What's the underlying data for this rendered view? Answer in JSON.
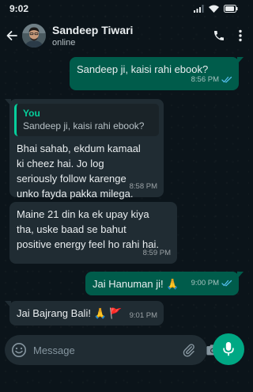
{
  "status_bar": {
    "time": "9:02"
  },
  "header": {
    "contact_name": "Sandeep Tiwari",
    "contact_status": "online"
  },
  "messages": [
    {
      "direction": "out",
      "text": "Sandeep ji, kaisi rahi ebook?",
      "time": "8:56 PM",
      "read": true
    },
    {
      "direction": "in",
      "quote_author": "You",
      "quote_text": "Sandeep ji, kaisi rahi ebook?",
      "text": "Bhai sahab, ekdum kamaal ki cheez hai. Jo log seriously follow karenge unko fayda pakka milega.",
      "time": "8:58 PM"
    },
    {
      "direction": "in",
      "text": "Maine 21 din ka ek upay kiya tha, uske baad se bahut positive energy feel ho rahi hai.",
      "time": "8:59 PM"
    },
    {
      "direction": "out",
      "text": "Jai Hanuman ji! 🙏",
      "time": "9:00 PM",
      "read": true
    },
    {
      "direction": "in",
      "text": "Jai Bajrang Bali! 🙏 🚩",
      "time": "9:01 PM"
    }
  ],
  "composer": {
    "placeholder": "Message"
  },
  "colors": {
    "background": "#0b141a",
    "outgoing_bubble": "#005c4b",
    "incoming_bubble": "#202c33",
    "accent": "#00a884",
    "read_ticks": "#53bdeb"
  },
  "icons": [
    "back-arrow-icon",
    "phone-icon",
    "more-vertical-icon",
    "emoji-icon",
    "paperclip-icon",
    "camera-icon",
    "microphone-icon",
    "double-check-icon"
  ]
}
